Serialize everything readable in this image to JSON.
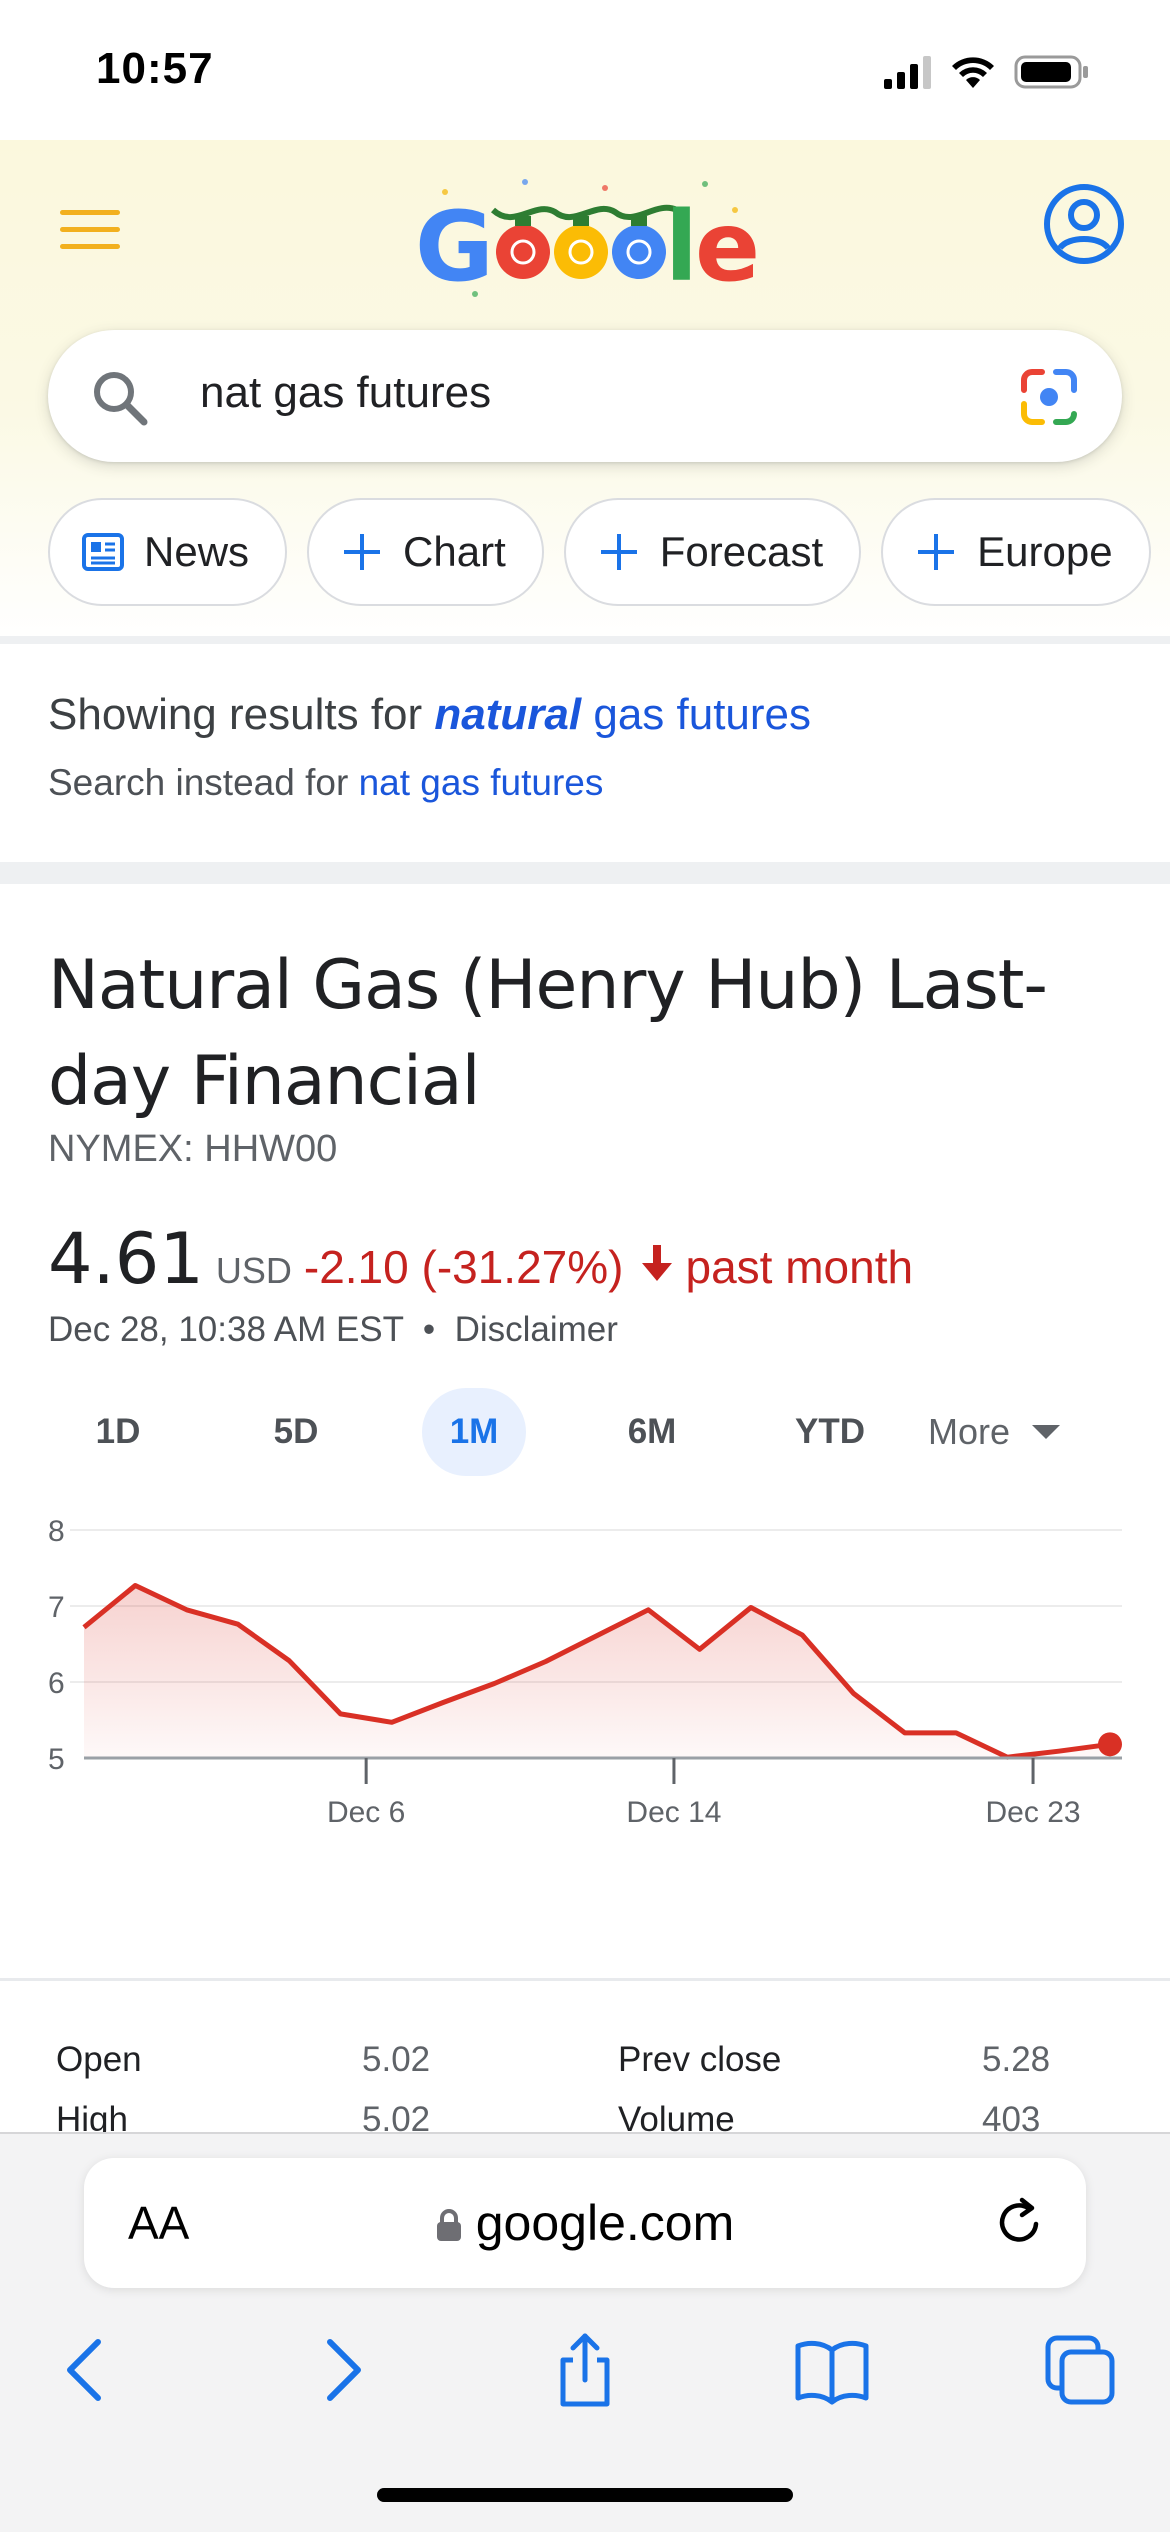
{
  "status_bar": {
    "time": "10:57"
  },
  "search": {
    "query": "nat gas futures"
  },
  "chips": [
    {
      "label": "News",
      "icon": "news-icon"
    },
    {
      "label": "Chart",
      "icon": "plus-icon"
    },
    {
      "label": "Forecast",
      "icon": "plus-icon"
    },
    {
      "label": "Europe",
      "icon": "plus-icon"
    }
  ],
  "spelling": {
    "prefix": "Showing results for",
    "corrected_emphasis": "natural",
    "corrected_rest": "gas futures",
    "instead_prefix": "Search instead for",
    "instead_query": "nat gas futures"
  },
  "finance": {
    "title": "Natural Gas (Henry Hub) Last-day Financial",
    "symbol": "NYMEX: HHW00",
    "price": "4.61",
    "currency": "USD",
    "change": "-2.10 (-31.27%)",
    "period": "past month",
    "timestamp": "Dec 28, 10:38 AM EST",
    "disclaimer": "Disclaimer",
    "ranges": [
      "1D",
      "5D",
      "1M",
      "6M",
      "YTD"
    ],
    "active_range": "1M",
    "more_label": "More",
    "colors": {
      "negative": "#c5221f",
      "accent": "#1a73e8"
    }
  },
  "chart_data": {
    "type": "area",
    "y_ticks": [
      "8",
      "7",
      "6",
      "5"
    ],
    "ylim": [
      5,
      8
    ],
    "x_tick_labels": [
      "Dec 6",
      "Dec 14",
      "Dec 23"
    ],
    "grid": true,
    "series": [
      {
        "values": [
          6.72,
          7.27,
          6.95,
          6.76,
          6.28,
          5.58,
          5.47,
          5.73,
          5.98,
          6.27,
          6.61,
          6.95,
          6.43,
          6.98,
          6.62,
          5.85,
          5.33,
          5.33,
          5.01,
          5.09,
          5.18
        ]
      }
    ],
    "color": "#d93025"
  },
  "stats": [
    {
      "label": "Open",
      "value": "5.02"
    },
    {
      "label": "Prev close",
      "value": "5.28"
    },
    {
      "label": "High",
      "value": "5.02"
    },
    {
      "label": "Volume",
      "value": "403"
    }
  ],
  "safari": {
    "text_size_label": "AA",
    "url": "google.com"
  }
}
